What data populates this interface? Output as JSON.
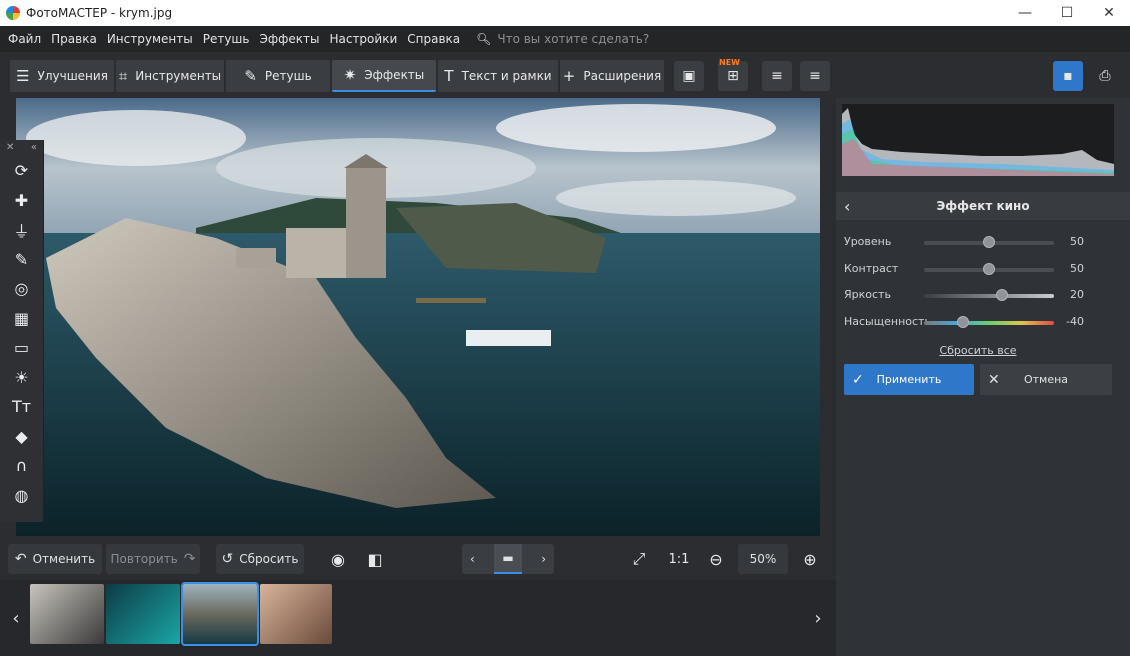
{
  "window": {
    "title": "ФотоМАСТЕР - krym.jpg",
    "minimize": "—",
    "maximize": "☐",
    "close": "✕"
  },
  "menu": {
    "items": [
      "Файл",
      "Правка",
      "Инструменты",
      "Ретушь",
      "Эффекты",
      "Настройки",
      "Справка"
    ],
    "search_placeholder": "Что вы хотите сделать?"
  },
  "tabs": [
    {
      "label": "Улучшения",
      "icon": "sliders-icon"
    },
    {
      "label": "Инструменты",
      "icon": "crop-icon"
    },
    {
      "label": "Ретушь",
      "icon": "brush-icon"
    },
    {
      "label": "Эффекты",
      "icon": "magic-wand-icon",
      "active": true
    },
    {
      "label": "Текст и рамки",
      "icon": "text-icon"
    },
    {
      "label": "Расширения",
      "icon": "plus-icon"
    }
  ],
  "toolbar_extras": {
    "new_badge": "NEW"
  },
  "sidetools": [
    "rotate-icon",
    "bandage-icon",
    "stamp-icon",
    "brush-icon",
    "radial-icon",
    "grid-icon",
    "vignette-icon",
    "sun-icon",
    "text-icon",
    "fill-icon",
    "magnet-icon",
    "globe-icon"
  ],
  "bottom": {
    "undo": "Отменить",
    "redo": "Повторить",
    "reset": "Сбросить",
    "zoom_1to1": "1:1",
    "zoom": "50%"
  },
  "panel": {
    "effect_title": "Эффект кино",
    "sliders": [
      {
        "label": "Уровень",
        "value": "50",
        "fraction": 0.5
      },
      {
        "label": "Контраст",
        "value": "50",
        "fraction": 0.5
      },
      {
        "label": "Яркость",
        "value": "20",
        "fraction": 0.6
      },
      {
        "label": "Насыщенность",
        "value": "-40",
        "fraction": 0.3
      }
    ],
    "reset_all": "Сбросить все",
    "apply": "Применить",
    "cancel": "Отмена"
  },
  "colors": {
    "accent": "#3a8ee6",
    "apply": "#2f77c9"
  }
}
